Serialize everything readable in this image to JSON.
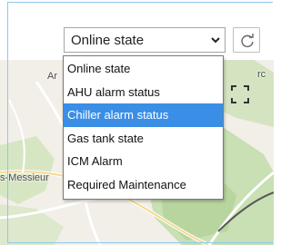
{
  "select": {
    "value": "Online state",
    "options": [
      "Online state",
      "AHU alarm status",
      "Chiller alarm status",
      "Gas tank state",
      "ICM Alarm",
      "Required Maintenance"
    ],
    "highlighted_index": 2
  },
  "map": {
    "place_labels": [
      "s-Messieur",
      "Ar",
      "rc"
    ]
  },
  "icons": {
    "dropdown": "chevron-down-icon",
    "refresh": "refresh-icon",
    "fullscreen": "fullscreen-icon"
  },
  "colors": {
    "highlight": "#3a8ee6",
    "panel_border": "#8ec8e8"
  }
}
